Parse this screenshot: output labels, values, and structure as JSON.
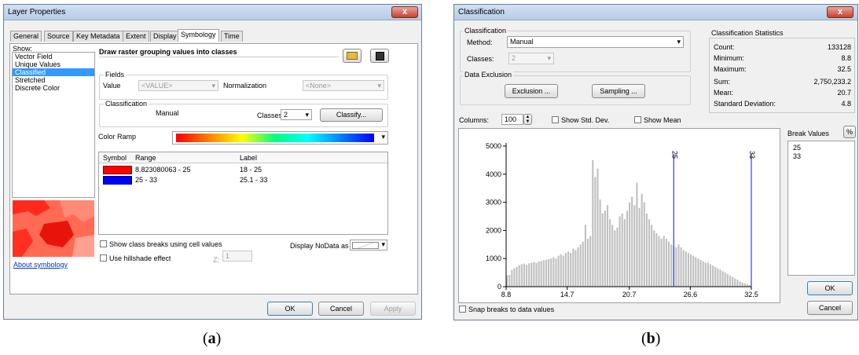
{
  "left": {
    "title": "Layer Properties",
    "tabs": [
      "General",
      "Source",
      "Key Metadata",
      "Extent",
      "Display",
      "Symbology",
      "Time"
    ],
    "show_label": "Show:",
    "show_items": [
      "Vector Field",
      "Unique Values",
      "Classified",
      "Stretched",
      "Discrete Color"
    ],
    "heading": "Draw raster grouping values into classes",
    "fields_label": "Fields",
    "value_label": "Value",
    "value_field": "<VALUE>",
    "norm_label": "Normalization",
    "norm_field": "<None>",
    "classification_label": "Classification",
    "method": "Manual",
    "classes_label": "Classes",
    "classes_value": "2",
    "classify_btn": "Classify...",
    "color_ramp_label": "Color Ramp",
    "table_headers": [
      "Symbol",
      "Range",
      "Label"
    ],
    "rows": [
      {
        "color": "#ff0000",
        "range": "8.823080063 - 25",
        "label": "18 - 25"
      },
      {
        "color": "#0000ff",
        "range": "25 - 33",
        "label": "25.1 - 33"
      }
    ],
    "show_class_breaks": "Show class breaks using cell values",
    "use_hillshade": "Use hillshade effect",
    "z_label": "Z:",
    "z_value": "1",
    "nodata_label": "Display NoData as",
    "about": "About symbology",
    "ok": "OK",
    "cancel": "Cancel",
    "apply": "Apply"
  },
  "right": {
    "title": "Classification",
    "classification_label": "Classification",
    "method_label": "Method:",
    "method": "Manual",
    "classes_label": "Classes:",
    "classes_value": "2",
    "data_exclusion": "Data Exclusion",
    "exclusion_btn": "Exclusion ...",
    "sampling_btn": "Sampling ...",
    "stats_title": "Classification Statistics",
    "stats": [
      {
        "k": "Count:",
        "v": "133128"
      },
      {
        "k": "Minimum:",
        "v": "8.8"
      },
      {
        "k": "Maximum:",
        "v": "32.5"
      },
      {
        "k": "Sum:",
        "v": "2,750,233.2"
      },
      {
        "k": "Mean:",
        "v": "20.7"
      },
      {
        "k": "Standard Deviation:",
        "v": "4.8"
      }
    ],
    "columns_label": "Columns:",
    "columns_value": "100",
    "show_std": "Show Std. Dev.",
    "show_mean": "Show Mean",
    "break_values_label": "Break Values",
    "pct": "%",
    "break_values": [
      "25",
      "33"
    ],
    "snap": "Snap breaks to data values",
    "ok": "OK",
    "cancel": "Cancel"
  },
  "chart_data": {
    "type": "bar",
    "title": "",
    "xlabel": "",
    "ylabel": "",
    "xlim": [
      8.8,
      32.5
    ],
    "ylim": [
      0,
      5000
    ],
    "x_ticks": [
      "8.8",
      "14.7",
      "20.7",
      "26.6",
      "32.5"
    ],
    "y_ticks": [
      "0",
      "1000",
      "2000",
      "3000",
      "4000",
      "5000"
    ],
    "bin_start": 8.8,
    "bin_width": 0.237,
    "values": [
      400,
      420,
      600,
      650,
      700,
      760,
      800,
      820,
      780,
      830,
      850,
      870,
      850,
      900,
      920,
      940,
      960,
      980,
      1000,
      1050,
      1000,
      1100,
      1150,
      1100,
      1200,
      1250,
      1200,
      1350,
      1300,
      1400,
      1500,
      1600,
      2200,
      1700,
      1800,
      4500,
      3900,
      4200,
      3100,
      2600,
      2700,
      2900,
      2400,
      2200,
      2000,
      2100,
      2500,
      2600,
      2400,
      2700,
      3000,
      3200,
      2900,
      3700,
      2800,
      3300,
      3000,
      2600,
      2400,
      2200,
      2000,
      1900,
      1800,
      1700,
      1800,
      1700,
      1600,
      1500,
      1450,
      1400,
      1500,
      1400,
      1300,
      1250,
      1200,
      1150,
      1100,
      1050,
      1000,
      950,
      900,
      850,
      850,
      800,
      750,
      700,
      650,
      600,
      550,
      500,
      450,
      400,
      350,
      300,
      250,
      200,
      150,
      120,
      90,
      60
    ],
    "breaks": [
      {
        "label": "25",
        "value": 25
      },
      {
        "label": "33",
        "value": 32.5
      }
    ],
    "bar_color": "#c0c0c0",
    "break_color": "#3c3cdc"
  },
  "captions": {
    "a": "a",
    "b": "b"
  }
}
